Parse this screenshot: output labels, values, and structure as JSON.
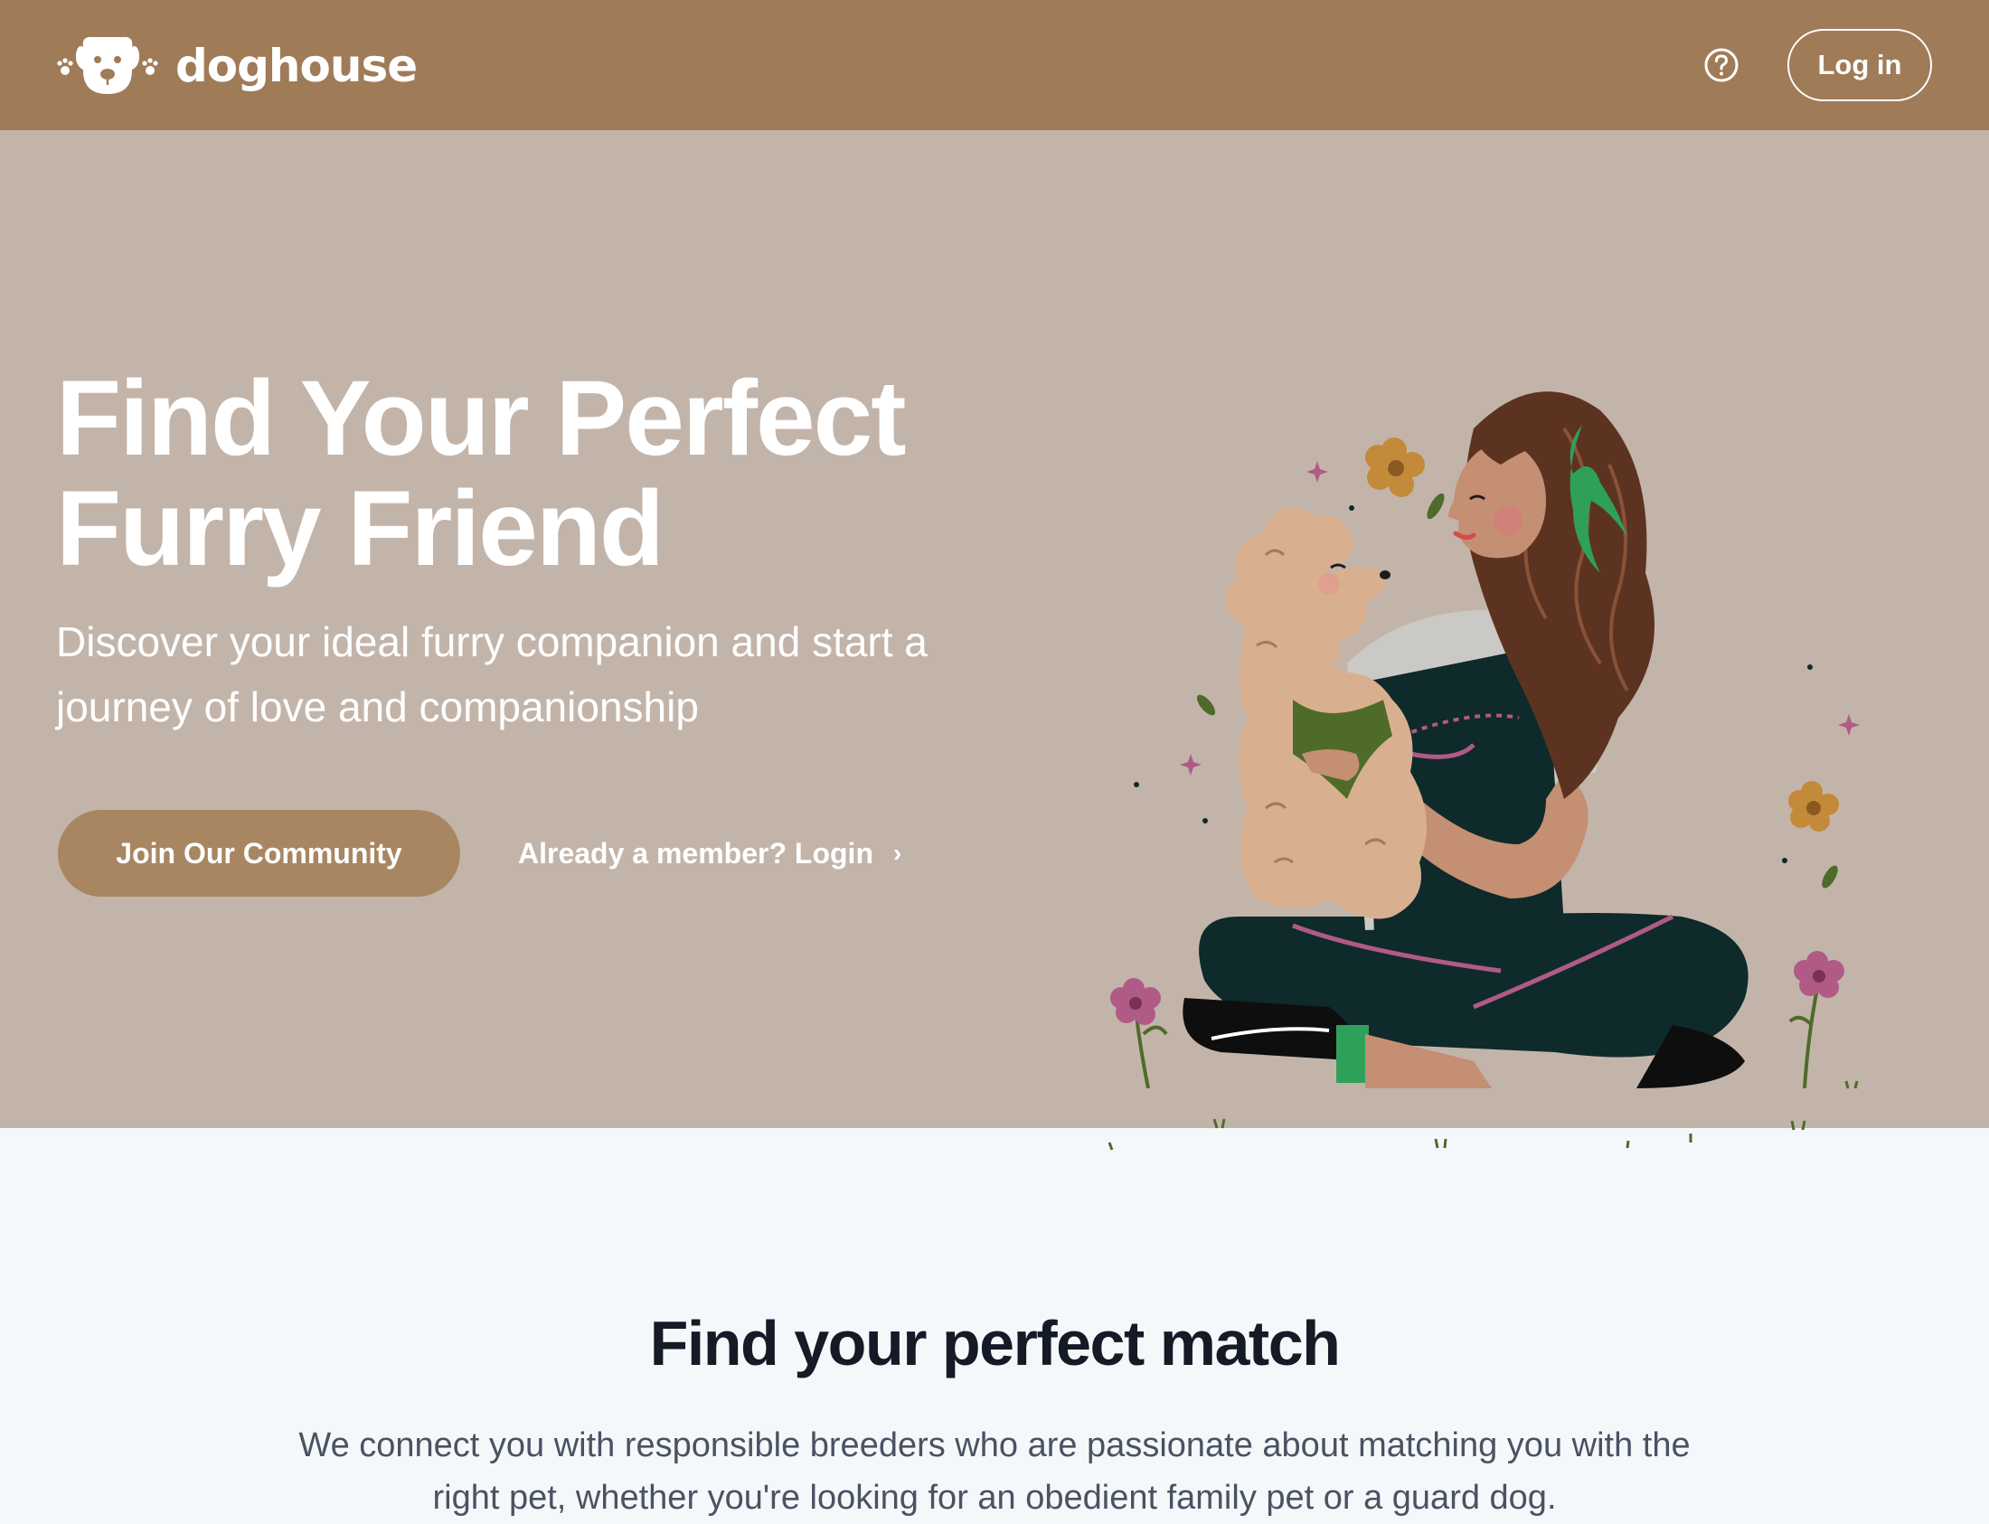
{
  "header": {
    "brand": "doghouse",
    "logo_icon": "dog-face-with-paws-icon",
    "help_icon": "question-circle-icon",
    "login_label": "Log in",
    "background_color": "#a07b58"
  },
  "hero": {
    "title": "Find Your Perfect Furry Friend",
    "subtitle": "Discover your ideal furry companion and start a journey of love and companionship",
    "primary_button": "Join Our Community",
    "secondary_link": "Already a member? Login",
    "secondary_link_icon": "chevron-right-icon",
    "background_color": "#c3b4aa",
    "button_color": "#a88661",
    "illustration": "woman-sitting-cross-legged-hugging-poodle-illustration"
  },
  "match_section": {
    "title": "Find your perfect match",
    "text": "We connect you with responsible breeders who are passionate about matching you with the right pet, whether you're looking for an obedient family pet or a guard dog."
  }
}
